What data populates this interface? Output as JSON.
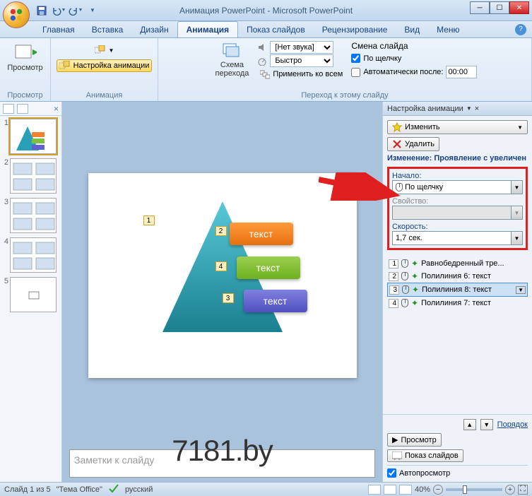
{
  "titlebar": {
    "title": "Анимация PowerPoint - Microsoft PowerPoint"
  },
  "ribbon_tabs": [
    "Главная",
    "Вставка",
    "Дизайн",
    "Анимация",
    "Показ слайдов",
    "Рецензирование",
    "Вид",
    "Меню"
  ],
  "active_tab_index": 3,
  "ribbon": {
    "preview_group": {
      "button": "Просмотр",
      "label": "Просмотр"
    },
    "anim_group": {
      "custom": "Настройка анимации",
      "box_icon": "⬚",
      "label": "Анимация"
    },
    "transition_group": {
      "scheme": "Схема\nперехода",
      "sound_label": "[Нет звука]",
      "speed_label": "Быстро",
      "apply_all": "Применить ко всем",
      "change_label": "Смена слайда",
      "on_click": "По щелчку",
      "auto_after": "Автоматически после:",
      "auto_time": "00:00",
      "label": "Переход к этому слайду"
    }
  },
  "thumbs": {
    "slides": [
      1,
      2,
      3,
      4,
      5
    ],
    "selected": 1
  },
  "slide": {
    "tag1": "1",
    "tag2": "2",
    "tag3": "3",
    "tag4": "4",
    "text1": "текст",
    "text2": "текст",
    "text3": "текст",
    "watermark": "7181.by"
  },
  "notes_placeholder": "Заметки к слайду",
  "taskpane": {
    "title": "Настройка анимации",
    "change_btn": "Изменить",
    "delete_btn": "Удалить",
    "change_label": "Изменение: Проявление с увеличен",
    "start_label": "Начало:",
    "start_value": "По щелчку",
    "property_label": "Свойство:",
    "property_value": "",
    "speed_label": "Скорость:",
    "speed_value": "1,7 сек.",
    "anim_items": [
      {
        "n": "1",
        "name": "Равнобедренный тре..."
      },
      {
        "n": "2",
        "name": "Полилиния 6: текст"
      },
      {
        "n": "3",
        "name": "Полилиния 8: текст"
      },
      {
        "n": "4",
        "name": "Полилиния 7: текст"
      }
    ],
    "selected_anim": 2,
    "reorder": "Порядок",
    "play": "Просмотр",
    "slideshow": "Показ слайдов",
    "autopreview": "Автопросмотр"
  },
  "statusbar": {
    "slide_info": "Слайд 1 из 5",
    "theme": "\"Тема Office\"",
    "lang": "русский",
    "zoom": "40%"
  }
}
